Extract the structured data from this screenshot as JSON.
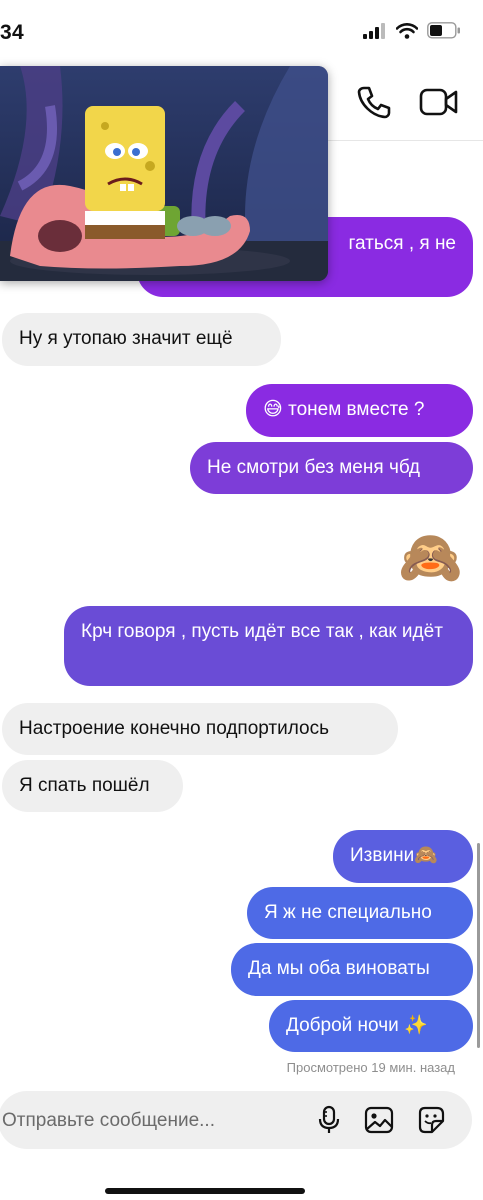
{
  "status_bar": {
    "time": "34"
  },
  "header": {
    "call_icon": "phone-icon",
    "video_icon": "video-camera-icon"
  },
  "pip": {
    "description_icon": "video-thumbnail"
  },
  "messages": [
    {
      "dir": "out",
      "text": "гаться , я не"
    },
    {
      "dir": "in",
      "text": "Ну я утопаю значит ещё"
    },
    {
      "dir": "out",
      "text": "😅 тонем вместе ?"
    },
    {
      "dir": "out",
      "text": "Не смотри без меня чбд"
    },
    {
      "dir": "out",
      "text": "🙈"
    },
    {
      "dir": "out",
      "text": "Крч говоря , пусть идёт все так , как идёт"
    },
    {
      "dir": "in",
      "text": "Настроение конечно подпортилось"
    },
    {
      "dir": "in",
      "text": "Я спать пошёл"
    },
    {
      "dir": "out",
      "text": "Извини🙈"
    },
    {
      "dir": "out",
      "text": "Я ж не специально"
    },
    {
      "dir": "out",
      "text": "Да мы оба виноваты"
    },
    {
      "dir": "out",
      "text": "Доброй ночи ✨"
    }
  ],
  "seen_text": "Просмотрено 19 мин. назад",
  "composer": {
    "placeholder": "Отправьте сообщение...",
    "mic_icon": "microphone-icon",
    "gallery_icon": "image-icon",
    "sticker_icon": "sticker-icon"
  },
  "colors": {
    "accent_purple": "#8a2be2",
    "accent_blue": "#4e6ae6",
    "incoming_bg": "#efefef"
  }
}
